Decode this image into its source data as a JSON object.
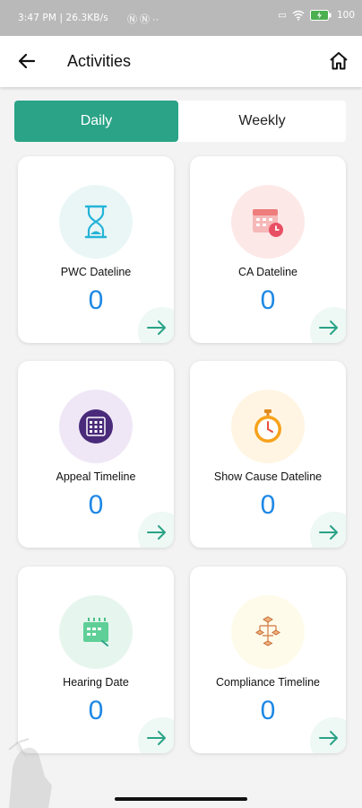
{
  "status_bar": {
    "time_speed": "3:47 PM | 26.3KB/s",
    "battery": "100"
  },
  "header": {
    "title": "Activities"
  },
  "tabs": [
    {
      "label": "Daily",
      "active": true
    },
    {
      "label": "Weekly",
      "active": false
    }
  ],
  "cards": [
    {
      "label": "PWC Dateline",
      "count": "0",
      "icon": "hourglass-icon",
      "bg": "#eaf6f6"
    },
    {
      "label": "CA Dateline",
      "count": "0",
      "icon": "calendar-clock-icon",
      "bg": "#fde8e8"
    },
    {
      "label": "Appeal Timeline",
      "count": "0",
      "icon": "calendar-grid-icon",
      "bg": "#efe7f6"
    },
    {
      "label": "Show Cause Dateline",
      "count": "0",
      "icon": "stopwatch-icon",
      "bg": "#fff5e2"
    },
    {
      "label": "Hearing Date",
      "count": "0",
      "icon": "calendar-icon",
      "bg": "#e6f6ee"
    },
    {
      "label": "Compliance Timeline",
      "count": "0",
      "icon": "flowchart-icon",
      "bg": "#fffbea"
    }
  ],
  "colors": {
    "accent": "#2aa387",
    "count": "#1e88e5"
  }
}
